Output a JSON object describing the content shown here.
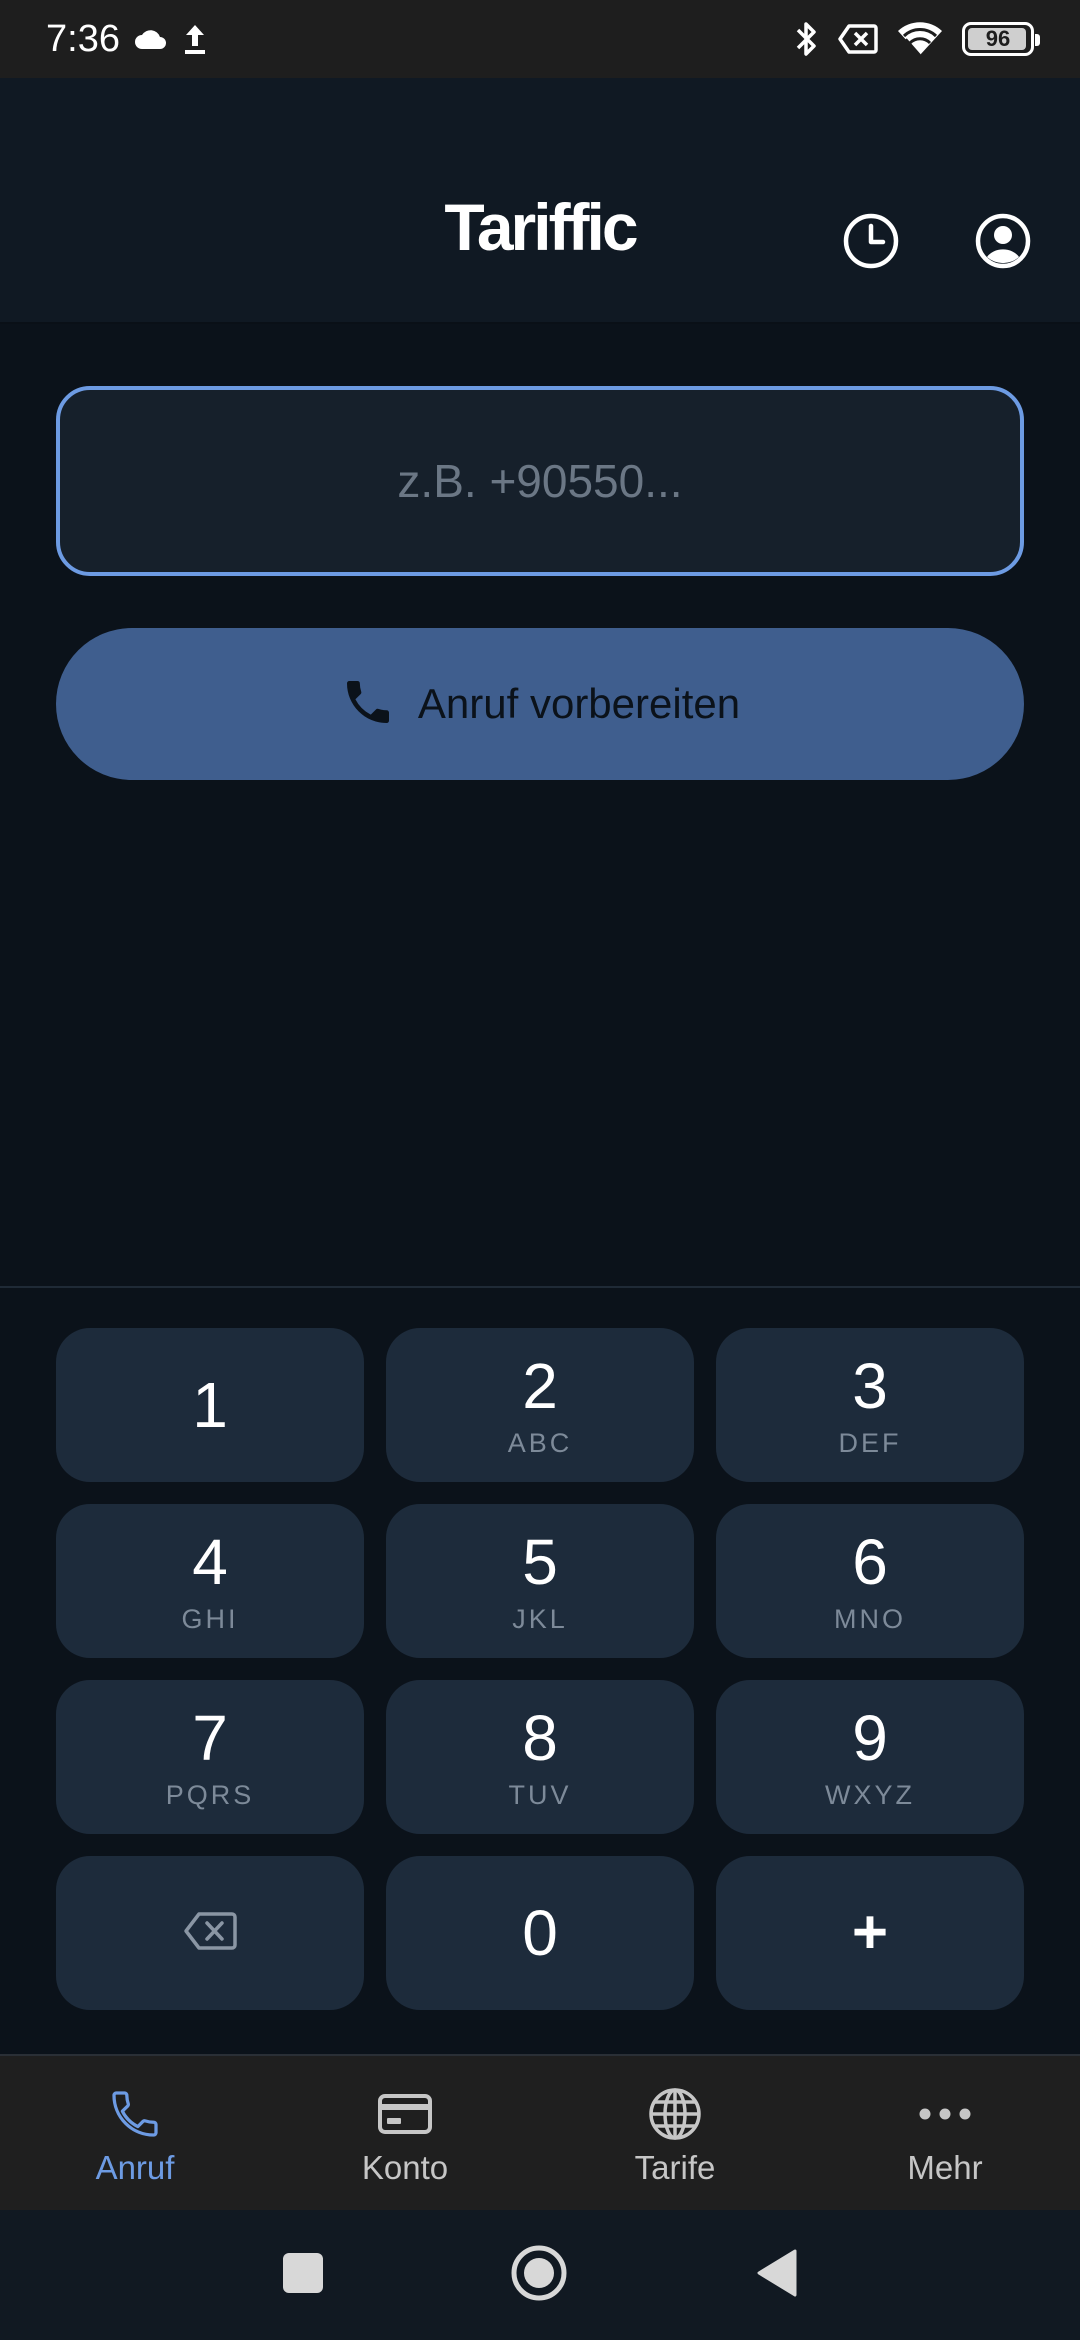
{
  "status_bar": {
    "time": "7:36",
    "battery_level": "96",
    "battery_fraction": 0.96,
    "icons": [
      "cloud-icon",
      "upload-icon",
      "bluetooth-icon",
      "no-sim-icon",
      "wifi-icon",
      "battery-icon"
    ]
  },
  "header": {
    "title": "Tariffic",
    "history_icon": "history-icon",
    "account_icon": "account-circle-icon"
  },
  "phone_input": {
    "value": "",
    "placeholder": "z.B. +90550..."
  },
  "call_button": {
    "label": "Anruf vorbereiten",
    "icon": "phone-icon"
  },
  "keypad": {
    "keys": [
      {
        "digit": "1",
        "letters": ""
      },
      {
        "digit": "2",
        "letters": "ABC"
      },
      {
        "digit": "3",
        "letters": "DEF"
      },
      {
        "digit": "4",
        "letters": "GHI"
      },
      {
        "digit": "5",
        "letters": "JKL"
      },
      {
        "digit": "6",
        "letters": "MNO"
      },
      {
        "digit": "7",
        "letters": "PQRS"
      },
      {
        "digit": "8",
        "letters": "TUV"
      },
      {
        "digit": "9",
        "letters": "WXYZ"
      }
    ],
    "backspace_icon": "backspace-icon",
    "zero": "0",
    "plus": "+"
  },
  "bottom_nav": {
    "items": [
      {
        "label": "Anruf",
        "icon": "phone-icon",
        "active": true
      },
      {
        "label": "Konto",
        "icon": "credit-card-icon",
        "active": false
      },
      {
        "label": "Tarife",
        "icon": "globe-icon",
        "active": false
      },
      {
        "label": "Mehr",
        "icon": "more-horizontal-icon",
        "active": false
      }
    ]
  },
  "colors": {
    "background": "#0b121a",
    "header": "#101923",
    "accent": "#6d9be3",
    "call_button": "#3f5e8e",
    "key": "#1d2b3b",
    "nav_active": "#6d9be3",
    "nav_inactive": "#c6c6c6"
  }
}
